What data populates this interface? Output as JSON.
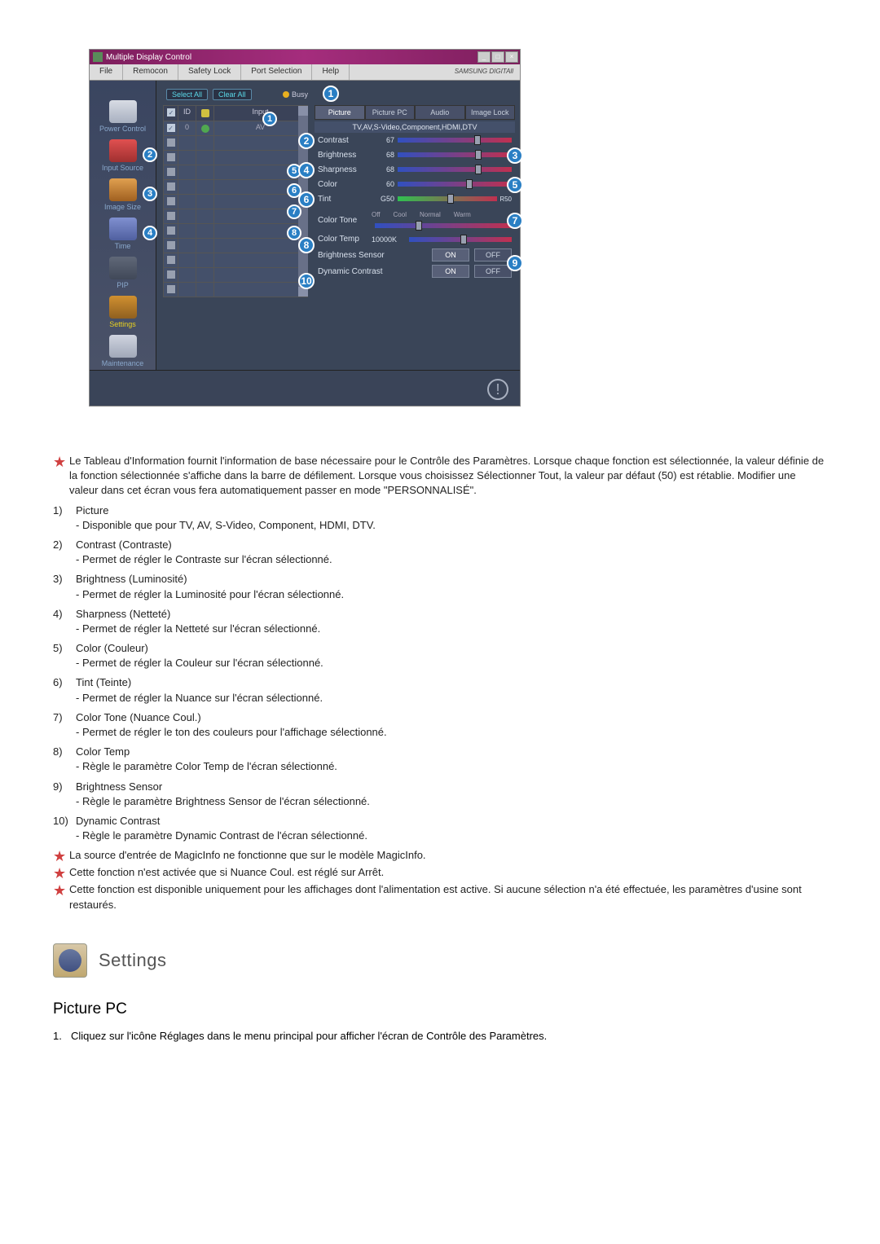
{
  "app": {
    "title": "Multiple Display Control",
    "menu": [
      "File",
      "Remocon",
      "Safety Lock",
      "Port Selection",
      "Help"
    ],
    "logo": "SAMSUNG DIGITAll"
  },
  "sidebar": [
    {
      "label": "Power Control",
      "icon": "power"
    },
    {
      "label": "Input Source",
      "icon": "input",
      "callout": "2"
    },
    {
      "label": "Image Size",
      "icon": "image",
      "callout": "3"
    },
    {
      "label": "Time",
      "icon": "time",
      "callout": "4"
    },
    {
      "label": "PIP",
      "icon": "pip"
    },
    {
      "label": "Settings",
      "icon": "settings",
      "active": true
    },
    {
      "label": "Maintenance",
      "icon": "maint"
    }
  ],
  "table": {
    "selectAll": "Select All",
    "clearAll": "Clear All",
    "busy": "Busy",
    "headers": {
      "id": "ID",
      "input": "Input"
    },
    "rows": [
      {
        "checked": true,
        "id": "0",
        "status": "green",
        "input": "AV"
      },
      {
        "checked": false
      },
      {
        "checked": false
      },
      {
        "checked": false
      },
      {
        "checked": false
      },
      {
        "checked": false
      },
      {
        "checked": false
      },
      {
        "checked": false
      },
      {
        "checked": false
      },
      {
        "checked": false
      },
      {
        "checked": false
      },
      {
        "checked": false
      }
    ],
    "callouts": {
      "header": "1",
      "c5": "5",
      "c6": "6",
      "c7": "7",
      "c8": "8"
    }
  },
  "settings": {
    "tabs": [
      "Picture",
      "Picture PC",
      "Audio",
      "Image Lock"
    ],
    "subheader": "TV,AV,S-Video,Component,HDMI,DTV",
    "contrast": {
      "label": "Contrast",
      "value": "67"
    },
    "brightness": {
      "label": "Brightness",
      "value": "68"
    },
    "sharpness": {
      "label": "Sharpness",
      "value": "68"
    },
    "color": {
      "label": "Color",
      "value": "60"
    },
    "tint": {
      "label": "Tint",
      "value": "G50",
      "rvalue": "R50"
    },
    "colorTone": {
      "label": "Color Tone",
      "opts": [
        "Off",
        "Cool",
        "Normal",
        "Warm"
      ]
    },
    "colorTemp": {
      "label": "Color Temp",
      "value": "10000K"
    },
    "brightnessSensor": {
      "label": "Brightness Sensor",
      "on": "ON",
      "off": "OFF"
    },
    "dynamicContrast": {
      "label": "Dynamic Contrast",
      "on": "ON",
      "off": "OFF"
    },
    "callouts": {
      "c1": "1",
      "c2": "2",
      "c3": "3",
      "c4": "4",
      "c5": "5",
      "c6": "6",
      "c7": "7",
      "c8": "8",
      "c9": "9",
      "c10": "10"
    }
  },
  "stars": {
    "s1": "Le Tableau d'Information fournit l'information de base nécessaire pour le Contrôle des Paramètres. Lorsque chaque fonction est sélectionnée, la valeur définie de la fonction sélectionnée s'affiche dans la barre de défilement. Lorsque vous choisissez Sélectionner Tout, la valeur par défaut (50) est rétablie. Modifier une valeur dans cet écran vous fera automatiquement passer en mode \"PERSONNALISÉ\".",
    "s2": "La source d'entrée de MagicInfo ne fonctionne que sur le modèle MagicInfo.",
    "s3": "Cette fonction n'est activée que si Nuance Coul. est réglé sur Arrêt.",
    "s4": "Cette fonction est disponible uniquement pour les affichages dont l'alimentation est active. Si aucune sélection n'a été effectuée, les paramètres d'usine sont restaurés."
  },
  "numList": [
    {
      "n": "1)",
      "title": "Picture",
      "desc": "- Disponible que pour TV, AV, S-Video, Component, HDMI, DTV."
    },
    {
      "n": "2)",
      "title": "Contrast (Contraste)",
      "desc": "- Permet de régler le Contraste sur l'écran sélectionné."
    },
    {
      "n": "3)",
      "title": "Brightness (Luminosité)",
      "desc": "- Permet de régler la Luminosité pour l'écran sélectionné."
    },
    {
      "n": "4)",
      "title": "Sharpness (Netteté)",
      "desc": "- Permet de régler la Netteté sur l'écran sélectionné."
    },
    {
      "n": "5)",
      "title": "Color (Couleur)",
      "desc": "- Permet de régler la Couleur sur l'écran sélectionné."
    },
    {
      "n": "6)",
      "title": "Tint (Teinte)",
      "desc": "- Permet de régler la Nuance sur l'écran sélectionné."
    },
    {
      "n": "7)",
      "title": "Color Tone (Nuance Coul.)",
      "desc": "- Permet de régler le ton des couleurs pour l'affichage sélectionné."
    },
    {
      "n": "8)",
      "title": "Color Temp",
      "desc": "- Règle le paramètre Color Temp de l'écran sélectionné."
    },
    {
      "n": "9)",
      "title": "Brightness Sensor",
      "desc": "- Règle le paramètre Brightness Sensor de l'écran sélectionné."
    },
    {
      "n": "10)",
      "title": "Dynamic Contrast",
      "desc": "- Règle le paramètre Dynamic Contrast de l'écran sélectionné."
    }
  ],
  "section": {
    "title": "Settings",
    "subtitle": "Picture PC",
    "step1": "Cliquez sur l'icône Réglages dans le menu principal pour afficher l'écran de Contrôle des Paramètres."
  }
}
